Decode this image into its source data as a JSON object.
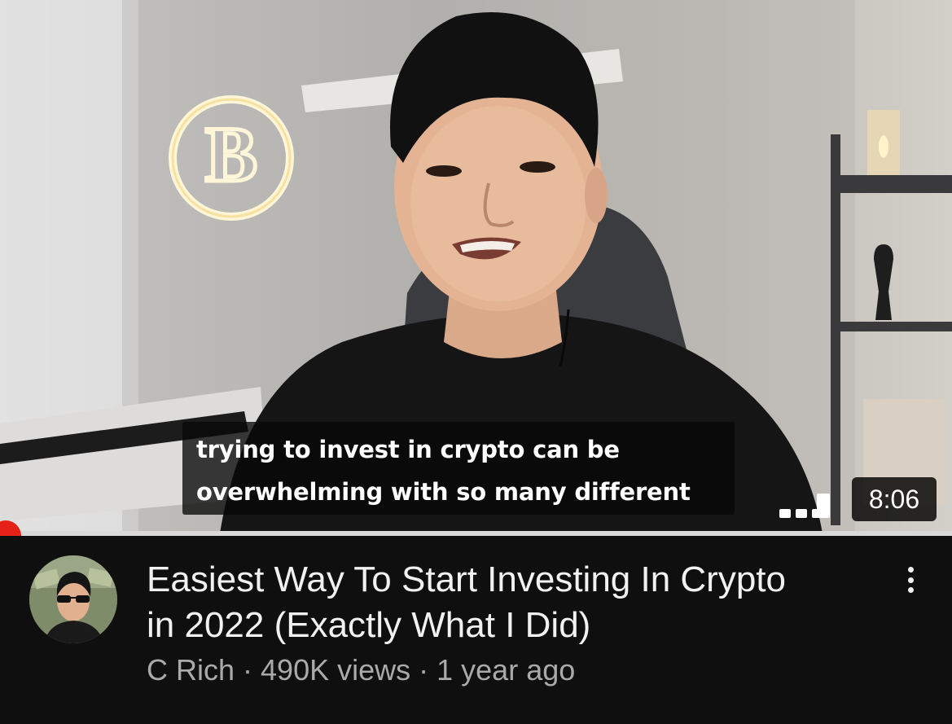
{
  "video": {
    "captions": [
      "trying to invest in crypto can be",
      "overwhelming with so many different"
    ],
    "duration": "8:06",
    "watch_progress": 0.01
  },
  "info": {
    "title_lines": [
      "Easiest Way To Start Investing In Crypto",
      "in 2022 (Exactly What I Did)"
    ],
    "channel": "C Rich",
    "separator": " · ",
    "views": "490K views",
    "age": "1 year ago"
  },
  "icons": {
    "signal": "signal-strength-icon",
    "menu": "more-vert-icon"
  },
  "colors": {
    "background": "#0f0f0f",
    "title": "#f1f1f1",
    "meta": "#aaaaaa",
    "progress": "#ff0000"
  }
}
